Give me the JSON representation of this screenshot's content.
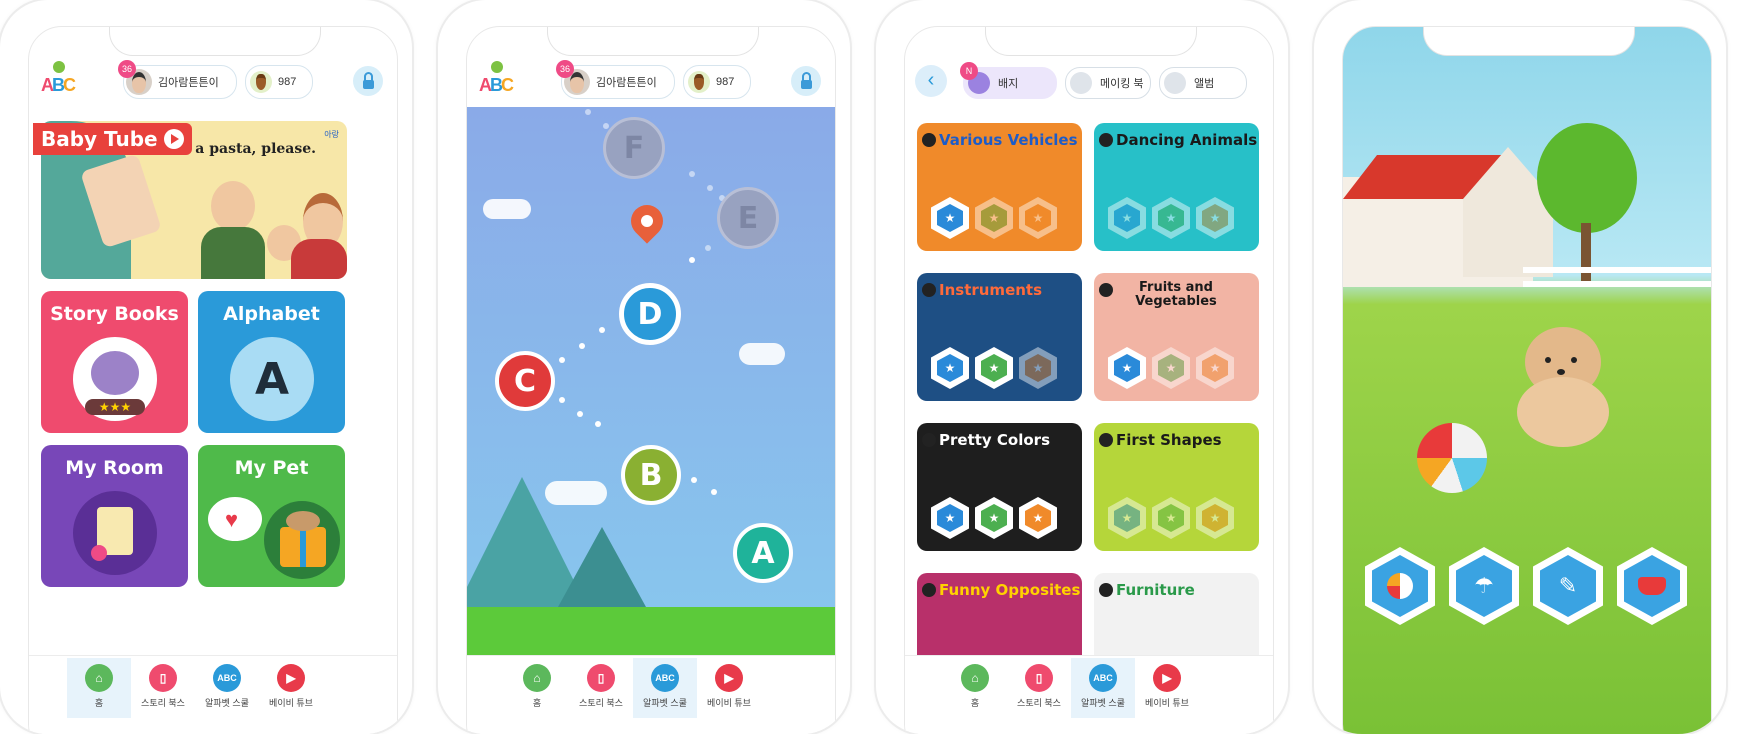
{
  "colors": {
    "pink": "#ef4b6e",
    "blue": "#2a9ad9",
    "purple": "#7847b8",
    "green": "#4fba4a",
    "accent_red": "#e83a4a"
  },
  "profile": {
    "level": "36",
    "name": "김아람튼튼이",
    "coins": "987"
  },
  "nav": [
    {
      "label": "홈",
      "icon": "home-icon",
      "color": "#5cb85c"
    },
    {
      "label": "스토리 북스",
      "icon": "book-icon",
      "color": "#ef4b6e"
    },
    {
      "label": "알파벳 스쿨",
      "icon": "abc-block-icon",
      "color": "#2a9ad9"
    },
    {
      "label": "베이비 튜브",
      "icon": "play-icon",
      "color": "#e83a4a"
    }
  ],
  "screen1": {
    "banner": {
      "brand": "Baby Tube",
      "caption": "l like a pasta, please.",
      "corner": "아랑"
    },
    "cards": [
      {
        "title": "Story Books",
        "color": "#ef4b6e"
      },
      {
        "title": "Alphabet",
        "color": "#2a9ad9",
        "letter": "A"
      },
      {
        "title": "My Room",
        "color": "#7847b8"
      },
      {
        "title": "My Pet",
        "color": "#4fba4a"
      }
    ],
    "stars": "★★★"
  },
  "screen2": {
    "levels": [
      {
        "letter": "F",
        "state": "locked"
      },
      {
        "letter": "E",
        "state": "locked"
      },
      {
        "letter": "D",
        "state": "current"
      },
      {
        "letter": "C",
        "state": "done"
      },
      {
        "letter": "B",
        "state": "done"
      },
      {
        "letter": "A",
        "state": "done"
      }
    ]
  },
  "screen3": {
    "new_badge": "N",
    "tabs": [
      {
        "label": "배지"
      },
      {
        "label": "메이킹 북"
      },
      {
        "label": "앨범"
      }
    ],
    "books": [
      {
        "title": "Various Vehicles",
        "bg": "#f08a2a",
        "text": "#1d5cc8"
      },
      {
        "title": "Dancing Animals",
        "bg": "#27c0c8",
        "text": "#1a1a1a"
      },
      {
        "title": "Instruments",
        "bg": "#1e4f84",
        "text": "#ff6a3a"
      },
      {
        "title": "Fruits and Vegetables",
        "bg": "#f2b4a4",
        "text": "#1a1a1a"
      },
      {
        "title": "Pretty Colors",
        "bg": "#1e1e1e",
        "text": "#ffffff"
      },
      {
        "title": "First Shapes",
        "bg": "#b5d63a",
        "text": "#1a1a1a"
      },
      {
        "title": "Funny Opposites",
        "bg": "#b8306a",
        "text": "#ffd200"
      },
      {
        "title": "Furniture",
        "bg": "#f2f2f2",
        "text": "#2a9a4a"
      }
    ]
  },
  "screen4": {
    "actions": [
      {
        "icon": "ball-icon"
      },
      {
        "icon": "shower-icon"
      },
      {
        "icon": "broom-icon"
      },
      {
        "icon": "food-bowl-icon"
      }
    ]
  }
}
